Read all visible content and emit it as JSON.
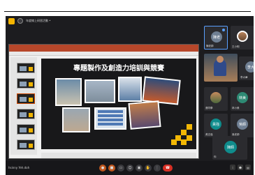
{
  "window": {
    "title": "年度線上研習活動 •"
  },
  "slide": {
    "title": "專題製作及創造力培訓與競賽"
  },
  "participants": [
    {
      "name": "陳老師",
      "initials": "陳老",
      "active": true,
      "color": "#6f7f93"
    },
    {
      "name": "王小明",
      "initials": "",
      "active": false,
      "color": "#b9845c"
    },
    {
      "name": "李大華",
      "initials": "李大",
      "active": false,
      "color": "#6f7f93"
    },
    {
      "name": "張同學",
      "initials": "",
      "active": false,
      "color": "#c58a5e"
    },
    {
      "name": "林小美",
      "initials": "林美",
      "active": false,
      "color": "#2e8a74"
    },
    {
      "name": "黃志強",
      "initials": "黃強",
      "active": false,
      "color": "#0f8c8c"
    },
    {
      "name": "吳老師",
      "initials": "吳師",
      "active": false,
      "color": "#6f7f93"
    }
  ],
  "self": {
    "name": "你",
    "initials": "陳師"
  },
  "bottombar": {
    "user_label": "hsinny Yeh.doh"
  },
  "colors": {
    "accent": "#f4b400",
    "end_call": "#d93025",
    "slide_bg": "#18181a"
  }
}
